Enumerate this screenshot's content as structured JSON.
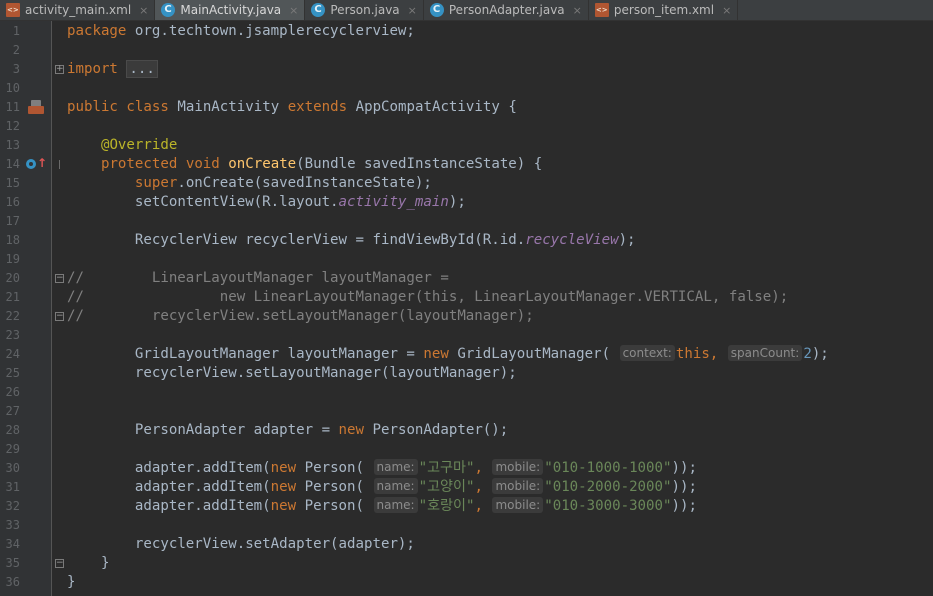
{
  "tabs": [
    {
      "label": "activity_main.xml",
      "icon": "xml-file-icon",
      "active": false
    },
    {
      "label": "MainActivity.java",
      "icon": "java-class-icon",
      "active": true
    },
    {
      "label": "Person.java",
      "icon": "java-class-icon",
      "active": false
    },
    {
      "label": "PersonAdapter.java",
      "icon": "java-class-icon",
      "active": false
    },
    {
      "label": "person_item.xml",
      "icon": "xml-file-icon",
      "active": false
    }
  ],
  "tab_close_glyph": "×",
  "editor": {
    "line_numbers": [
      "1",
      "2",
      "3",
      "10",
      "11",
      "12",
      "13",
      "14",
      "15",
      "16",
      "17",
      "18",
      "19",
      "20",
      "21",
      "22",
      "23",
      "24",
      "25",
      "26",
      "27",
      "28",
      "29",
      "30",
      "31",
      "32",
      "33",
      "34",
      "35",
      "36"
    ],
    "tokens": {
      "package_kw": "package",
      "package_name": " org.techtown.jsamplerecyclerview;",
      "import_kw": "import",
      "import_fold": "...",
      "public_kw": "public",
      "class_kw": "class",
      "class_name": "MainActivity",
      "extends_kw": "extends",
      "super_class": "AppCompatActivity {",
      "override_ann": "@Override",
      "protected_kw": "protected",
      "void_kw": "void",
      "oncreate_fn": "onCreate",
      "oncreate_params": "(Bundle savedInstanceState) {",
      "super_kw": "super",
      "super_call": ".onCreate(savedInstanceState);",
      "set_content_prefix": "setContentView(R.layout.",
      "activity_main_field": "activity_main",
      "set_content_suffix": ");",
      "rv_decl_prefix": "RecyclerView recyclerView = findViewById(R.id.",
      "recycle_view_field": "recycleView",
      "rv_decl_suffix": ");",
      "comment_20": "//        LinearLayoutManager layoutManager =",
      "comment_21": "//                new LinearLayoutManager(this, LinearLayoutManager.VERTICAL, false);",
      "comment_22": "//        recyclerView.setLayoutManager(layoutManager);",
      "grid_decl_prefix": "GridLayoutManager layoutManager = ",
      "new_kw": "new",
      "grid_ctor": " GridLayoutManager(",
      "hint_context": "context:",
      "this_kw": "this,",
      "hint_spancount": "spanCount:",
      "span_value": "2",
      "grid_decl_suffix": ");",
      "set_layout_manager": "recyclerView.setLayoutManager(layoutManager);",
      "adapter_decl_prefix": "PersonAdapter adapter = ",
      "adapter_ctor": " PersonAdapter();",
      "add_item_prefix": "adapter.addItem(",
      "person_ctor": " Person(",
      "hint_name": "name:",
      "hint_mobile": "mobile:",
      "comma": ",",
      "add_item_suffix": "));",
      "set_adapter": "recyclerView.setAdapter(adapter);",
      "close_brace": "}"
    },
    "items": [
      {
        "name": "\"고구마\"",
        "mobile": "\"010-1000-1000\""
      },
      {
        "name": "\"고양이\"",
        "mobile": "\"010-2000-2000\""
      },
      {
        "name": "\"호랑이\"",
        "mobile": "\"010-3000-3000\""
      }
    ]
  }
}
